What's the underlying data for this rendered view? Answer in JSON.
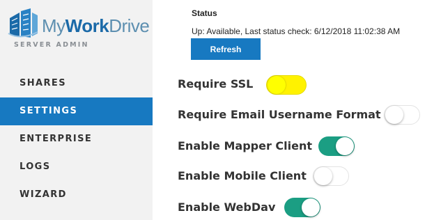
{
  "brand": {
    "logo_my": "My",
    "logo_work": "Work",
    "logo_drive": "Drive",
    "subtitle": "SERVER ADMIN"
  },
  "sidebar": {
    "items": [
      {
        "label": "SHARES",
        "active": false
      },
      {
        "label": "SETTINGS",
        "active": true
      },
      {
        "label": "ENTERPRISE",
        "active": false
      },
      {
        "label": "LOGS",
        "active": false
      },
      {
        "label": "WIZARD",
        "active": false
      }
    ]
  },
  "status": {
    "title": "Status",
    "text": "Up: Available, Last status check: 6/12/2018 11:02:38 AM",
    "refresh_label": "Refresh"
  },
  "settings": [
    {
      "label": "Require SSL",
      "enabled": false,
      "highlighted": true
    },
    {
      "label": "Require Email Username Format",
      "enabled": false,
      "highlighted": false
    },
    {
      "label": "Enable Mapper Client",
      "enabled": true,
      "highlighted": false
    },
    {
      "label": "Enable Mobile Client",
      "enabled": false,
      "highlighted": false
    },
    {
      "label": "Enable WebDav",
      "enabled": true,
      "highlighted": false
    }
  ],
  "colors": {
    "accent": "#1779c1",
    "toggle_on": "#1b9e83",
    "highlight": "#ffff00",
    "sidebar_bg": "#f2f2f2"
  }
}
